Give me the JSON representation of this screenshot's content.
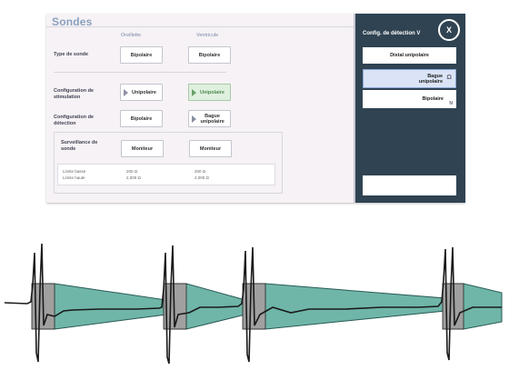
{
  "panel": {
    "title": "Sondes",
    "col_oreillette": "Oreillette",
    "col_ventricule": "Ventricule",
    "rows": {
      "type_sonde": {
        "label": "Type de sonde",
        "oreillette": "Bipolaire",
        "ventricule": "Bipolaire"
      },
      "config_stim": {
        "label": "Configuration de stimulation",
        "oreillette": "Unipolaire",
        "ventricule": "Unipolaire"
      },
      "config_detect": {
        "label": "Configuration de détection",
        "oreillette": "Bipolaire",
        "ventricule": "Bague unipolaire"
      }
    },
    "surveillance": {
      "label": "Surveillance de sonde",
      "oreillette": "Moniteur",
      "ventricule": "Moniteur",
      "limite_basse_label": "Limite basse",
      "limite_haute_label": "Limite haute",
      "limite_basse_o": "200 Ω",
      "limite_haute_o": "2,000 Ω",
      "limite_basse_v": "200 Ω",
      "limite_haute_v": "2,000 Ω"
    }
  },
  "popup": {
    "title": "Config. de détection V",
    "close_label": "X",
    "options": [
      "Distal unipolaire",
      "Bague unipolaire",
      "Bipolaire"
    ],
    "selected": "Bague unipolaire",
    "icon_selected": "Ω",
    "icon_bipolar": "N"
  },
  "colors": {
    "panel_bg": "#f6f2f5",
    "popup_bg": "#2f4352",
    "active_green": "#dff0df",
    "teal_field": "#6fb6a8",
    "gray_blank": "#a0a0a0"
  }
}
